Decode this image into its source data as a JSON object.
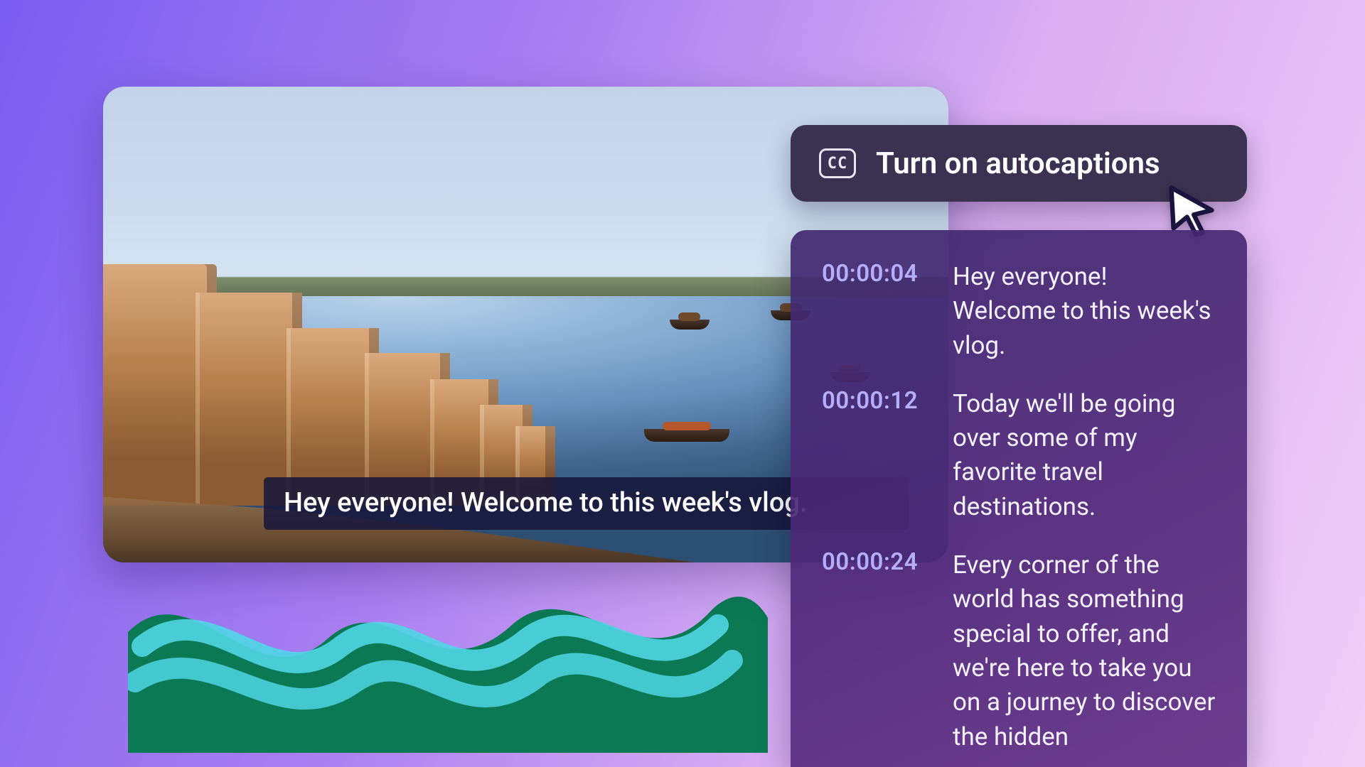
{
  "video": {
    "subtitle": "Hey everyone! Welcome to this week's vlog."
  },
  "autocaptions_button": {
    "icon_label": "CC",
    "label": "Turn on autocaptions"
  },
  "transcript": {
    "entries": [
      {
        "timestamp": "00:00:04",
        "text": "Hey everyone! Welcome to this week's vlog."
      },
      {
        "timestamp": "00:00:12",
        "text": "Today we'll be going over some of my favorite travel destinations."
      },
      {
        "timestamp": "00:00:24",
        "text": "Every corner of the world has something special to offer, and we're here to take you on a journey to discover the hidden"
      }
    ]
  }
}
